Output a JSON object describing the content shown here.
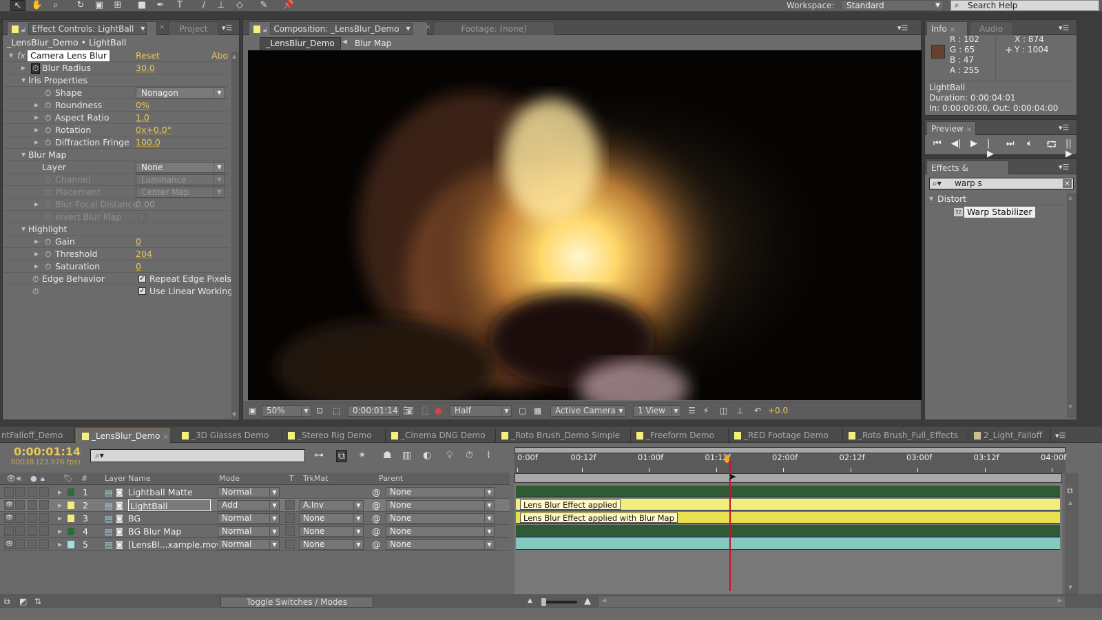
{
  "workspace": {
    "label": "Workspace:",
    "value": "Standard"
  },
  "search_help": {
    "placeholder": "Search Help"
  },
  "effect_controls": {
    "tab_label": "Effect Controls: LightBall",
    "project_tab": "Project",
    "breadcrumb": "_LensBlur_Demo • LightBall",
    "effect_name": "Camera Lens Blur",
    "reset_label": "Reset",
    "about_label": "Abo",
    "rows": [
      {
        "label": "Blur Radius",
        "value": "30.0"
      },
      {
        "label": "Iris Properties"
      },
      {
        "label": "Shape",
        "value": "Nonagon"
      },
      {
        "label": "Roundness",
        "value": "0%"
      },
      {
        "label": "Aspect Ratio",
        "value": "1.0"
      },
      {
        "label": "Rotation",
        "value": "0x+0.0°"
      },
      {
        "label": "Diffraction Fringe",
        "value": "100.0"
      },
      {
        "label": "Blur Map"
      },
      {
        "label": "Layer",
        "value": "None"
      },
      {
        "label": "Channel",
        "value": "Luminance"
      },
      {
        "label": "Placement",
        "value": "Center Map"
      },
      {
        "label": "Blur Focal Distance",
        "value": "0.00"
      },
      {
        "label": "Invert Blur Map",
        "checked": false
      },
      {
        "label": "Highlight"
      },
      {
        "label": "Gain",
        "value": "0"
      },
      {
        "label": "Threshold",
        "value": "204"
      },
      {
        "label": "Saturation",
        "value": "0"
      },
      {
        "label": "Edge Behavior",
        "value": "Repeat Edge Pixels",
        "checked": true
      },
      {
        "label": "",
        "value": "Use Linear Working",
        "checked": true
      }
    ]
  },
  "composition": {
    "tab_label": "Composition: _LensBlur_Demo",
    "footage_tab": "Footage: (none)",
    "breadcrumbs": [
      "_LensBlur_Demo",
      "Blur Map"
    ],
    "zoom": "50%",
    "timecode": "0:00:01:14",
    "resolution": "Half",
    "camera": "Active Camera",
    "views": "1 View",
    "exposure": "+0.0"
  },
  "info": {
    "tab_label": "Info",
    "audio_tab": "Audio",
    "r": "R : 102",
    "g": "G : 65",
    "b": "B : 47",
    "a": "A : 255",
    "x": "X : 874",
    "y": "Y : 1004",
    "color_hex": "#66412f",
    "layer_name": "LightBall",
    "duration": "Duration: 0:00:04:01",
    "in_out": "In: 0:00:00:00, Out: 0:00:04:00"
  },
  "preview": {
    "tab_label": "Preview"
  },
  "effects_presets": {
    "tab_label": "Effects & Presets",
    "search_value": "warp s",
    "category": "Distort",
    "item": "Warp Stabilizer"
  },
  "timeline": {
    "tabs": [
      "ntFalloff_Demo",
      "_LensBlur_Demo",
      "_3D Glasses Demo",
      "_Stereo Rig Demo",
      "_Cinema DNG Demo",
      "_Roto Brush_Demo Simple",
      "_Freeform Demo",
      "_RED Footage Demo",
      "_Roto Brush_Full_Effects",
      "2_Light_Falloff"
    ],
    "active_tab": 1,
    "timecode": "0:00:01:14",
    "frames": "00038 (23.976 fps)",
    "columns": {
      "name": "Layer Name",
      "mode": "Mode",
      "t": "T",
      "trkmat": "TrkMat",
      "parent": "Parent",
      "num": "#"
    },
    "layers": [
      {
        "num": "1",
        "name": "Lightball Matte",
        "mode": "Normal",
        "trkmat": "",
        "parent": "None",
        "label_color": "#2f6a3a",
        "visible": false,
        "bar_color": "#2e5a34"
      },
      {
        "num": "2",
        "name": "LightBall",
        "mode": "Add",
        "trkmat": "A.Inv",
        "parent": "None",
        "label_color": "#f3ee7a",
        "visible": true,
        "bar_color": "#f2ee7c",
        "comment": "Lens Blur Effect applied"
      },
      {
        "num": "3",
        "name": "BG",
        "mode": "Normal",
        "trkmat": "None",
        "parent": "None",
        "label_color": "#f3ee7a",
        "visible": true,
        "bar_color": "#e8e050",
        "comment": "Lens Blur Effect applied with Blur Map"
      },
      {
        "num": "4",
        "name": "BG Blur Map",
        "mode": "Normal",
        "trkmat": "None",
        "parent": "None",
        "label_color": "#2f6a3a",
        "visible": false,
        "bar_color": "#2e5a34"
      },
      {
        "num": "5",
        "name": "[LensBl...xample.mov]",
        "mode": "Normal",
        "trkmat": "None",
        "parent": "None",
        "label_color": "#9ee0dc",
        "visible": true,
        "bar_color": "#84c9c0"
      }
    ],
    "ruler_ticks": [
      "0:00f",
      "00:12f",
      "01:00f",
      "01:12f",
      "02:00f",
      "02:12f",
      "03:00f",
      "03:12f",
      "04:00f"
    ],
    "playhead_timecode": "0:00:01:14",
    "toggle_label": "Toggle Switches / Modes"
  }
}
